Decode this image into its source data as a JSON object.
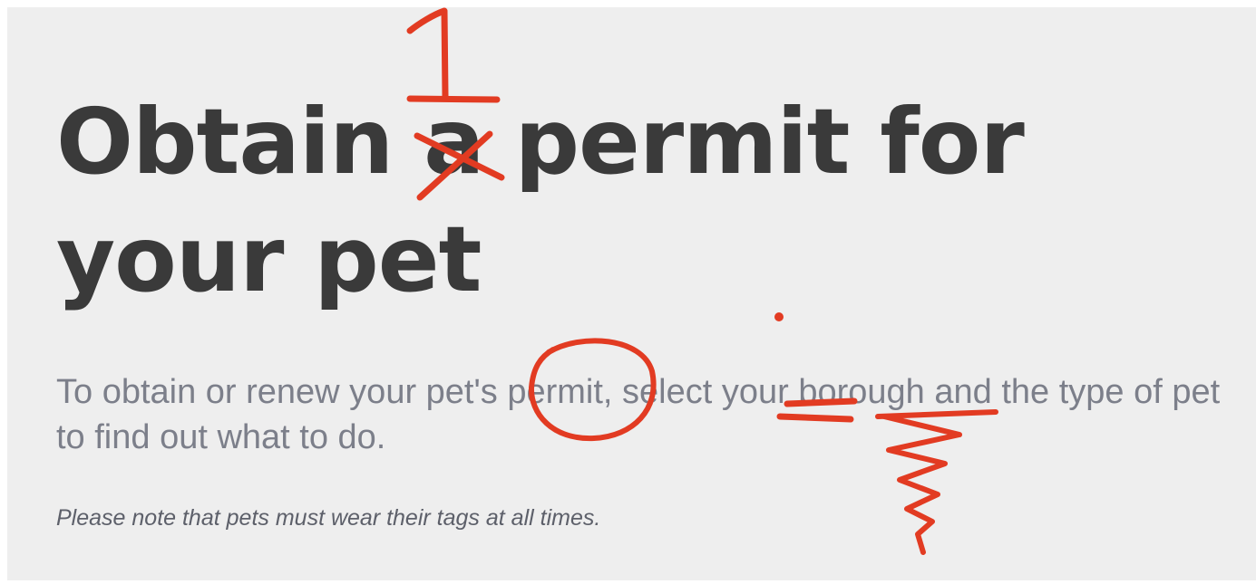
{
  "page": {
    "title": {
      "part1": "Obtain ",
      "article": "a",
      "part2": " permit for your pet"
    },
    "intro": {
      "before": "To obtain or renew your pet's ",
      "permit": "permit",
      "middle": ", select ",
      "your": "your",
      "space": " ",
      "borough": "borough",
      "after": " and the type of pet to find out what to do."
    },
    "note": "Please note that pets must wear their tags at all times."
  },
  "annotations": {
    "handwritten_number": "1",
    "ink_color": "#e23b22",
    "marks": [
      "number-one-mark",
      "strike-through-x-mark",
      "circle-mark",
      "equals-mark",
      "zigzag-underline-mark",
      "dot-mark"
    ]
  },
  "colors": {
    "background": "#eeeeee",
    "title": "#3a3a3a",
    "body_text": "#7c7f8a",
    "note_text": "#5d606a"
  }
}
